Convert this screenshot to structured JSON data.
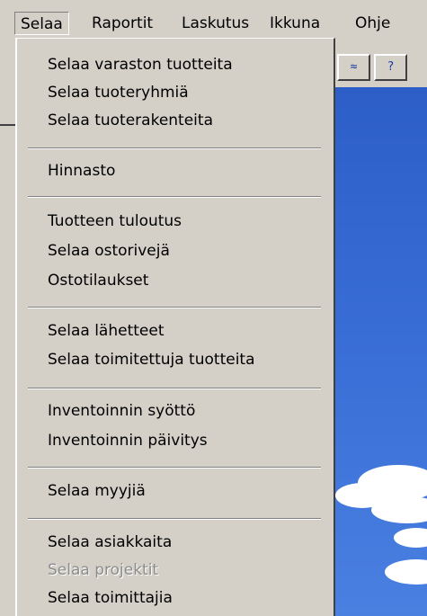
{
  "menubar": {
    "items": [
      "Selaa",
      "Raportit",
      "Laskutus",
      "Ikkuna",
      "Ohje"
    ]
  },
  "toolbar": {
    "button1_label": "≈",
    "button2_label": "?"
  },
  "menu": {
    "items": [
      {
        "label": "Selaa varaston tuotteita",
        "enabled": true
      },
      {
        "label": "Selaa tuoteryhmiä",
        "enabled": true
      },
      {
        "label": "Selaa tuoterakenteita",
        "enabled": true
      },
      {
        "label": "Hinnasto",
        "enabled": true
      },
      {
        "label": "Tuotteen tuloutus",
        "enabled": true
      },
      {
        "label": "Selaa ostorivejä",
        "enabled": true
      },
      {
        "label": "Ostotilaukset",
        "enabled": true
      },
      {
        "label": "Selaa lähetteet",
        "enabled": true
      },
      {
        "label": "Selaa toimitettuja tuotteita",
        "enabled": true
      },
      {
        "label": "Inventoinnin syöttö",
        "enabled": true
      },
      {
        "label": "Inventoinnin päivitys",
        "enabled": true
      },
      {
        "label": "Selaa myyjiä",
        "enabled": true
      },
      {
        "label": "Selaa asiakkaita",
        "enabled": true
      },
      {
        "label": "Selaa projektit",
        "enabled": false
      },
      {
        "label": "Selaa toimittajia",
        "enabled": true
      }
    ]
  }
}
